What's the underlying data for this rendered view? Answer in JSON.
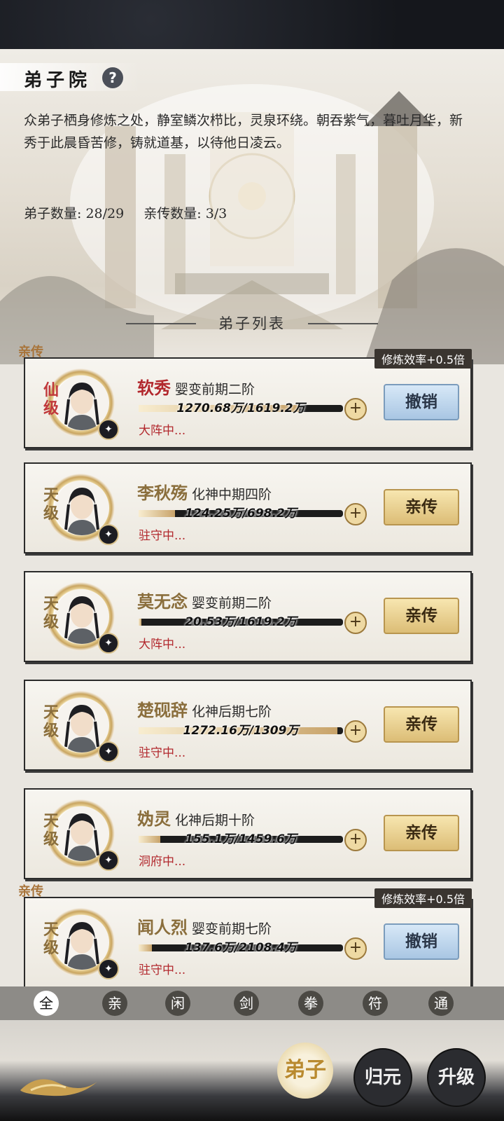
{
  "header": {
    "title": "弟子院",
    "help_icon": "?",
    "description": "众弟子栖身修炼之处，静室鳞次栉比，灵泉环绕。朝吞紫气，暮吐月华，新秀于此晨昏苦修，铸就道基，以待他日凌云。",
    "disciple_count_label": "弟子数量: 28/29",
    "direct_count_label": "亲传数量: 3/3"
  },
  "list_title": "弟子列表",
  "disciples": [
    {
      "name": "软秀",
      "realm": "婴变前期二阶",
      "grade": "仙级",
      "progress_text": "1270.68万/1619.2万",
      "progress": 0.785,
      "status": "大阵中...",
      "direct": true,
      "bonus": "修炼效率+0.5倍",
      "action": "撤销",
      "tag": "亲传"
    },
    {
      "name": "李秋殇",
      "realm": "化神中期四阶",
      "grade": "天级",
      "progress_text": "124.25万/698.2万",
      "progress": 0.178,
      "status": "驻守中...",
      "direct": false,
      "action": "亲传"
    },
    {
      "name": "莫无念",
      "realm": "婴变前期二阶",
      "grade": "天级",
      "progress_text": "20.53万/1619.2万",
      "progress": 0.013,
      "status": "大阵中...",
      "direct": false,
      "action": "亲传"
    },
    {
      "name": "楚砚辞",
      "realm": "化神后期七阶",
      "grade": "天级",
      "progress_text": "1272.16万/1309万",
      "progress": 0.972,
      "status": "驻守中...",
      "direct": false,
      "action": "亲传"
    },
    {
      "name": "妫灵",
      "realm": "化神后期十阶",
      "grade": "天级",
      "progress_text": "155.1万/1459.6万",
      "progress": 0.106,
      "status": "洞府中...",
      "direct": false,
      "action": "亲传"
    },
    {
      "name": "闻人烈",
      "realm": "婴变前期七阶",
      "grade": "天级",
      "progress_text": "137.6万/2108.4万",
      "progress": 0.065,
      "status": "驻守中...",
      "direct": true,
      "bonus": "修炼效率+0.5倍",
      "action": "撤销",
      "tag": "亲传"
    }
  ],
  "filters": [
    {
      "label": "全",
      "active": true
    },
    {
      "label": "亲",
      "active": false
    },
    {
      "label": "闲",
      "active": false
    },
    {
      "label": "剑",
      "active": false
    },
    {
      "label": "拳",
      "active": false
    },
    {
      "label": "符",
      "active": false
    },
    {
      "label": "通",
      "active": false
    }
  ],
  "bottom_nav": {
    "dizi": "弟子",
    "guiyuan": "归元",
    "shengji": "升级"
  },
  "colors": {
    "accent_gold": "#c8a36a",
    "name_red": "#b2282d",
    "direct_tag": "#a8743a"
  }
}
